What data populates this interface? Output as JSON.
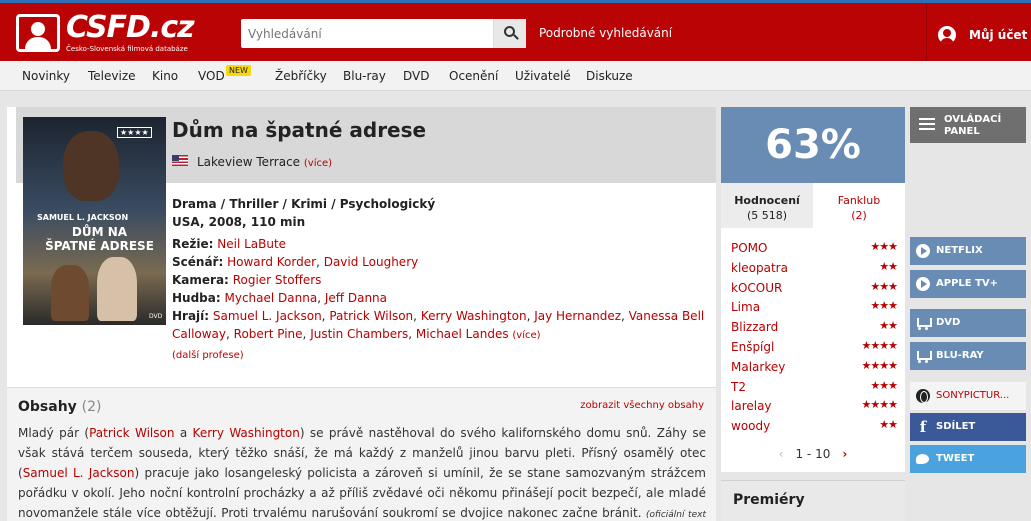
{
  "header": {
    "logo_text": "CSFD.cz",
    "logo_sub": "Česko-Slovenská filmová databáze",
    "search_placeholder": "Vyhledávání",
    "advanced_search": "Podrobné vyhledávání",
    "account": "Můj účet"
  },
  "nav": {
    "items": [
      "Novinky",
      "Televize",
      "Kino",
      "VOD",
      "Žebříčky",
      "Blu-ray",
      "DVD",
      "Ocenění",
      "Uživatelé",
      "Diskuze"
    ],
    "new_badge": "NEW"
  },
  "film": {
    "title": "Dům na špatné adrese",
    "original_title": "Lakeview Terrace",
    "more": "(více)",
    "genres": "Drama / Thriller / Krimi / Psychologický",
    "origin": "USA, 2008, 110 min",
    "poster": {
      "stars": "★★★★",
      "actor": "SAMUEL L. JACKSON",
      "title_line1": "DŮM NA",
      "title_line2": "ŠPATNÉ ADRESE",
      "dvd": "DVD"
    },
    "crew": {
      "director_label": "Režie:",
      "director": "Neil LaBute",
      "writer_label": "Scénář:",
      "writer_1": "Howard Korder",
      "writer_2": "David Loughery",
      "camera_label": "Kamera:",
      "camera": "Rogier Stoffers",
      "music_label": "Hudba:",
      "music_1": "Mychael Danna",
      "music_2": "Jeff Danna",
      "cast_label": "Hrají:",
      "cast": [
        "Samuel L. Jackson",
        "Patrick Wilson",
        "Kerry Washington",
        "Jay Hernandez",
        "Vanessa Bell Calloway",
        "Robert Pine",
        "Justin Chambers",
        "Michael Landes"
      ],
      "cast_more": "(více)",
      "more_professions": "(další profese)"
    }
  },
  "obsahy": {
    "title": "Obsahy",
    "count": "(2)",
    "show_all": "zobrazit všechny obsahy",
    "text_1": "Mladý pár (",
    "link_1": "Patrick Wilson",
    "text_2": " a ",
    "link_2": "Kerry Washington",
    "text_3": ") se právě nastěhoval do svého kalifornského domu snů. Záhy se však stává terčem souseda, který těžko snáší, že má každý z manželů jinou barvu pleti. Přísný osamělý otec (",
    "link_3": "Samuel L. Jackson",
    "text_4": ") pracuje jako losangeleský policista a zároveň si umínil, že se stane samozvaným strážcem pořádku v okolí. Jeho noční kontrolní procházky a až příliš zvědavé oči někomu přinášejí pocit bezpečí, ale mladé novomanžele stále více obtěžují. Proti trvalému narušování soukromí se dvojice nakonec začne bránit.",
    "source": "(oficiální text distributora)"
  },
  "rating": {
    "score": "63%",
    "tab_ratings_label": "Hodnocení",
    "tab_ratings_count": "(5 518)",
    "tab_fanclub_label": "Fanklub",
    "tab_fanclub_count": "(2)",
    "users": [
      {
        "name": "POMO",
        "stars": "★★★"
      },
      {
        "name": "kleopatra",
        "stars": "★★"
      },
      {
        "name": "kOCOUR",
        "stars": "★★★"
      },
      {
        "name": "Lima",
        "stars": "★★★"
      },
      {
        "name": "Blizzard",
        "stars": "★★"
      },
      {
        "name": "Enšpígl",
        "stars": "★★★★"
      },
      {
        "name": "Malarkey",
        "stars": "★★★★"
      },
      {
        "name": "T2",
        "stars": "★★★"
      },
      {
        "name": "larelay",
        "stars": "★★★★"
      },
      {
        "name": "woody",
        "stars": "★★"
      }
    ],
    "pager": "1 - 10",
    "prev": "‹",
    "next": "›"
  },
  "premiery": "Premiéry",
  "side": {
    "control_panel": "OVLÁDACÍ PANEL",
    "netflix": "NETFLIX",
    "appletv": "APPLE TV+",
    "dvd": "DVD",
    "bluray": "BLU-RAY",
    "sony": "SONYPICTUR...",
    "share": "SDÍLET",
    "tweet": "TWEET"
  },
  "colors": {
    "brand_red": "#ba0305",
    "score_blue": "#698cb4",
    "facebook": "#3b5998",
    "twitter": "#4aa3df",
    "link_red": "#b80000"
  }
}
